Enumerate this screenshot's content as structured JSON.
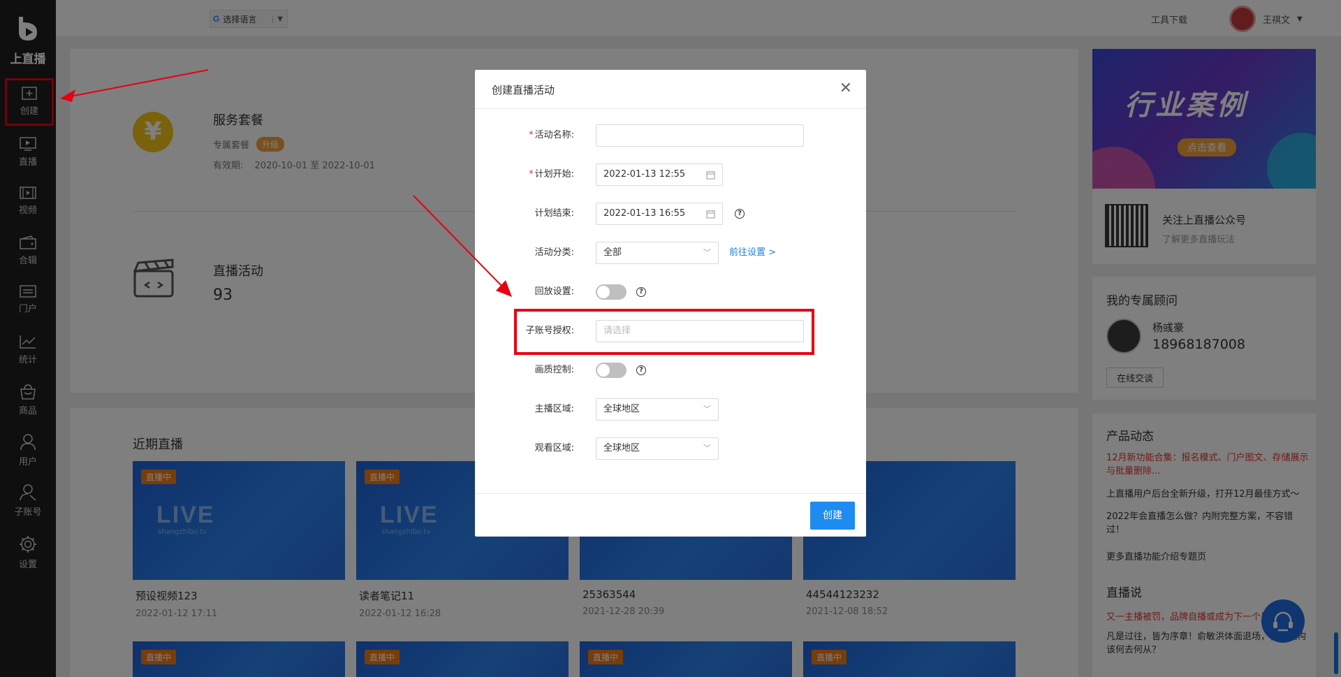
{
  "sidebar": {
    "logo_text": "上直播",
    "items": [
      {
        "label": "创建",
        "icon": "plus-square-icon"
      },
      {
        "label": "直播",
        "icon": "play-screen-icon"
      },
      {
        "label": "视频",
        "icon": "video-icon"
      },
      {
        "label": "合辑",
        "icon": "wallet-icon"
      },
      {
        "label": "门户",
        "icon": "portal-icon"
      },
      {
        "label": "统计",
        "icon": "chart-line-icon"
      },
      {
        "label": "商品",
        "icon": "bag-icon"
      },
      {
        "label": "用户",
        "icon": "user-icon"
      },
      {
        "label": "子账号",
        "icon": "sub-account-icon"
      },
      {
        "label": "设置",
        "icon": "gear-icon"
      }
    ]
  },
  "topbar": {
    "language": "选择语言",
    "tool_download": "工具下载",
    "username": "王祺文"
  },
  "service": {
    "title": "服务套餐",
    "plan": "专属套餐",
    "upgrade_badge": "升级",
    "validity_label": "有效期:",
    "validity_range": "2020-10-01 至 2022-10-01",
    "live_activity_title": "直播活动",
    "live_activity_count": "93"
  },
  "recent": {
    "title": "近期直播",
    "tag": "直播中",
    "live_text": "LIVE",
    "live_sub": "shangzhibo.tv",
    "cards": [
      {
        "name": "预设视频123",
        "date": "2022-01-12 17:11"
      },
      {
        "name": "读者笔记11",
        "date": "2022-01-12 16:28"
      },
      {
        "name": "25363544",
        "date": "2021-12-28 20:39"
      },
      {
        "name": "44544123232",
        "date": "2021-12-08 18:52"
      }
    ]
  },
  "right": {
    "banner_title": "行业案例",
    "banner_button": "点击查看",
    "follow_title": "关注上直播公众号",
    "follow_sub": "了解更多直播玩法",
    "advisor_title": "我的专属顾问",
    "advisor_name": "杨彧豪",
    "advisor_phone": "18968187008",
    "advisor_button": "在线交谈",
    "news_title": "产品动态",
    "news": [
      {
        "text": "12月新功能合集：报名模式、门户图文、存储展示与批量删除...",
        "highlight": true
      },
      {
        "text": "上直播用户后台全新升级，打开12月最佳方式～",
        "highlight": false
      },
      {
        "text": "2022年会直播怎么做？内附完整方案，不容错过！",
        "highlight": false
      },
      {
        "text": "更多直播功能介绍专题页",
        "highlight": false
      }
    ],
    "talk_title": "直播说",
    "talk_items": [
      {
        "text": "又一主播被罚，品牌自播或成为下一个风口",
        "highlight": true
      },
      {
        "text": "凡是过往，皆为序章！俞敏洪体面退场，教培机构该何去何从？",
        "highlight": false
      }
    ]
  },
  "dialog": {
    "title": "创建直播活动",
    "fields": {
      "name_label": "活动名称:",
      "name_value": "",
      "start_label": "计划开始:",
      "start_value": "2022-01-13 12:55",
      "end_label": "计划结束:",
      "end_value": "2022-01-13 16:55",
      "category_label": "活动分类:",
      "category_value": "全部",
      "category_link": "前往设置 >",
      "replay_label": "回放设置:",
      "sub_account_label": "子账号授权:",
      "sub_account_placeholder": "请选择",
      "quality_label": "画质控制:",
      "host_region_label": "主播区域:",
      "host_region_value": "全球地区",
      "view_region_label": "观看区域:",
      "view_region_value": "全球地区"
    },
    "create_button": "创建"
  },
  "colors": {
    "accent_blue": "#1e8bf0",
    "highlight_red": "#e60012",
    "sidebar_bg": "#1f1f1f"
  }
}
